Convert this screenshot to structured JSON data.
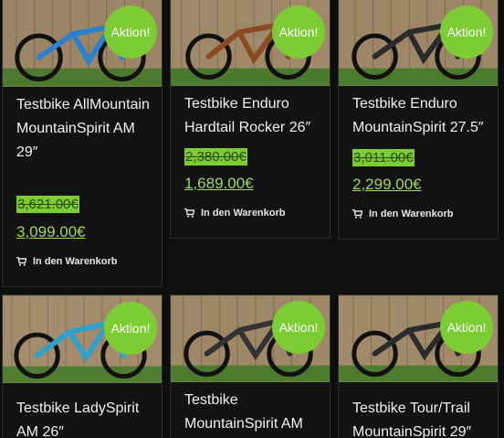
{
  "badge_color": "#7ccc33",
  "price_color": "#a4d65e",
  "products": [
    {
      "title": "Testbike AllMountain MountainSpirit AM 29″",
      "badge": "Aktion!",
      "old_price": "3,621.00€",
      "new_price": "3,099.00€",
      "cart_label": "In den Warenkorb",
      "bike_color": "#2f7fcf"
    },
    {
      "title": "Testbike Enduro Hardtail Rocker 26″",
      "badge": "Aktion!",
      "old_price": "2,380.00€",
      "new_price": "1,689.00€",
      "cart_label": "In den Warenkorb",
      "bike_color": "#8a4a22"
    },
    {
      "title": "Testbike Enduro MountainSpirit 27.5″",
      "badge": "Aktion!",
      "old_price": "3,011.00€",
      "new_price": "2,299.00€",
      "cart_label": "In den Warenkorb",
      "bike_color": "#2a2a2a"
    },
    {
      "title": "Testbike LadySpirit AM 26″",
      "badge": "Aktion!",
      "bike_color": "#2fa2cc"
    },
    {
      "title": "Testbike MountainSpirit AM",
      "badge": "Aktion!",
      "bike_color": "#333333"
    },
    {
      "title": "Testbike Tour/Trail MountainSpirit 29″",
      "badge": "Aktion!",
      "bike_color": "#2b2b2b"
    }
  ]
}
